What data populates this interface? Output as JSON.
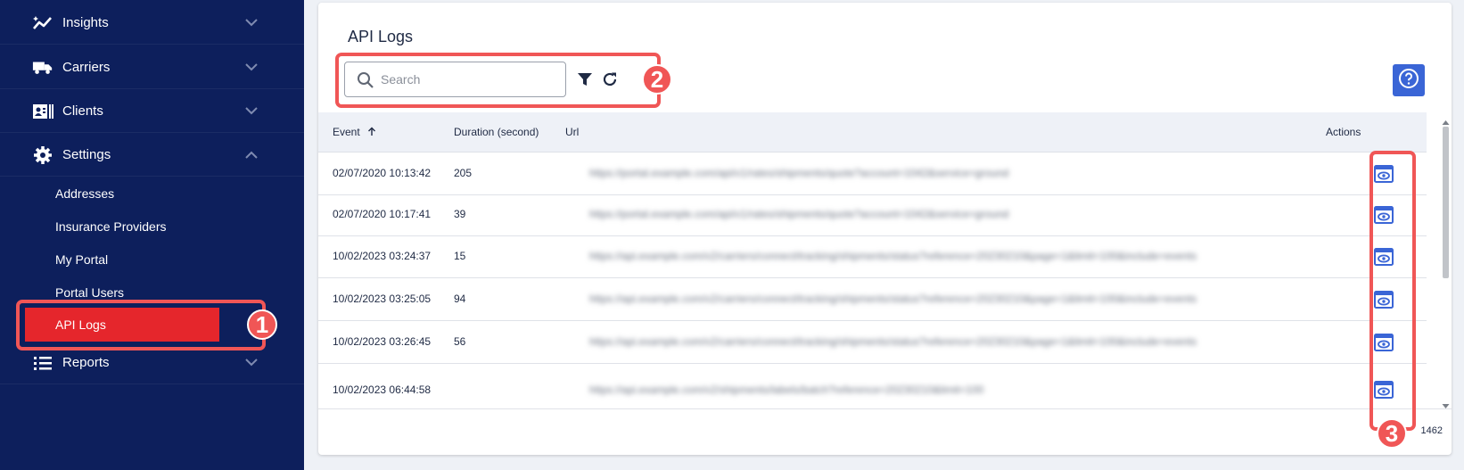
{
  "colors": {
    "sidebar_bg": "#0d1f5c",
    "active_item": "#e5262c",
    "accent": "#3a65d6",
    "annotation": "#f05656"
  },
  "sidebar": {
    "items": [
      {
        "label": "Insights",
        "icon": "insights-icon"
      },
      {
        "label": "Carriers",
        "icon": "truck-icon"
      },
      {
        "label": "Clients",
        "icon": "contact-card-icon"
      },
      {
        "label": "Settings",
        "icon": "gear-icon"
      },
      {
        "label": "Reports",
        "icon": "list-icon"
      }
    ],
    "settings_sub": [
      "Addresses",
      "Insurance Providers",
      "My Portal",
      "Portal Users"
    ],
    "active_sub": "API Logs"
  },
  "annotations": [
    "1",
    "2",
    "3"
  ],
  "page": {
    "title": "API Logs",
    "search": {
      "placeholder": "Search",
      "value": ""
    }
  },
  "table": {
    "headers": {
      "event": "Event",
      "duration": "Duration (second)",
      "url": "Url",
      "actions": "Actions"
    },
    "sort": {
      "column": "Event",
      "direction": "ascending"
    },
    "rows": [
      {
        "event": "02/07/2020 10:13:42",
        "duration": "205",
        "url": "https://portal.example.com/api/v1/rates/shipments/quote?account=1042&service=ground"
      },
      {
        "event": "02/07/2020 10:17:41",
        "duration": "39",
        "url": "https://portal.example.com/api/v1/rates/shipments/quote?account=1042&service=ground"
      },
      {
        "event": "10/02/2023 03:24:37",
        "duration": "15",
        "url": "https://api.example.com/v2/carriers/connect/tracking/shipments/status?reference=20230210&page=1&limit=100&include=events"
      },
      {
        "event": "10/02/2023 03:25:05",
        "duration": "94",
        "url": "https://api.example.com/v2/carriers/connect/tracking/shipments/status?reference=20230210&page=1&limit=100&include=events"
      },
      {
        "event": "10/02/2023 03:26:45",
        "duration": "56",
        "url": "https://api.example.com/v2/carriers/connect/tracking/shipments/status?reference=20230210&page=1&limit=100&include=events"
      },
      {
        "event": "10/02/2023 06:44:58",
        "duration": "",
        "url": "https://api.example.com/v2/shipments/labels/batch?reference=20230210&limit=100"
      }
    ]
  },
  "footer": {
    "count_text": "1462"
  }
}
